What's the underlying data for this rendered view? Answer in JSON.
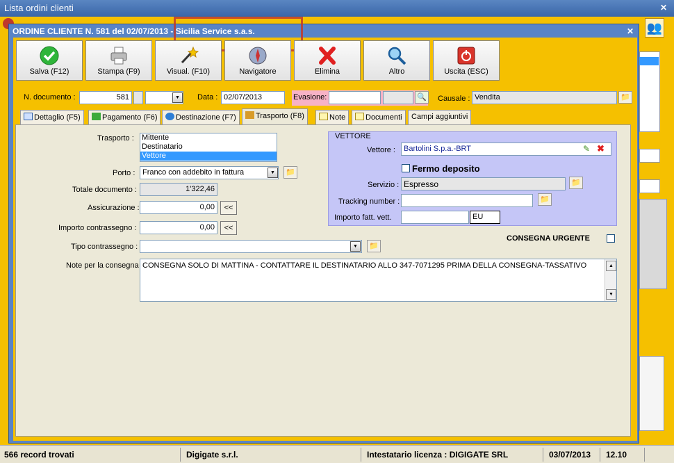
{
  "outer_window": {
    "title": "Lista ordini clienti"
  },
  "dialog": {
    "title": "ORDINE CLIENTE N. 581 del 02/07/2013 - Sicilia Service s.a.s."
  },
  "toolbar": [
    {
      "label": "Salva (F12)",
      "icon": "check-icon"
    },
    {
      "label": "Stampa (F9)",
      "icon": "printer-icon"
    },
    {
      "label": "Visual. (F10)",
      "icon": "magic-wand-icon"
    },
    {
      "label": "Navigatore",
      "icon": "compass-icon"
    },
    {
      "label": "Elimina",
      "icon": "delete-x-icon"
    },
    {
      "label": "Altro",
      "icon": "magnifier-icon"
    },
    {
      "label": "Uscita (ESC)",
      "icon": "exit-icon"
    }
  ],
  "header_fields": {
    "num_doc_label": "N. documento :",
    "num_doc_value": "581",
    "data_label": "Data :",
    "data_value": "02/07/2013",
    "evasione_label": "Evasione:",
    "evasione_value": "",
    "causale_label": "Causale :",
    "causale_value": "Vendita"
  },
  "tabs": [
    {
      "label": "Dettaglio (F5)",
      "active": false
    },
    {
      "label": "Pagamento (F6)",
      "active": false
    },
    {
      "label": "Destinazione (F7)",
      "active": false
    },
    {
      "label": "Trasporto (F8)",
      "active": true
    },
    {
      "label": "Note",
      "active": false
    },
    {
      "label": "Documenti",
      "active": false
    },
    {
      "label": "Campi aggiuntivi",
      "active": false
    }
  ],
  "trasporto": {
    "trasporto_label": "Trasporto :",
    "trasporto_options": [
      "Mittente",
      "Destinatario",
      "Vettore"
    ],
    "trasporto_selected": "Vettore",
    "porto_label": "Porto :",
    "porto_value": "Franco con addebito in fattura",
    "totale_label": "Totale documento :",
    "totale_value": "1'322,46",
    "assicurazione_label": "Assicurazione :",
    "assicurazione_value": "0,00",
    "contrassegno_label": "Importo contrassegno :",
    "contrassegno_value": "0,00",
    "tipo_contrassegno_label": "Tipo contrassegno :",
    "tipo_contrassegno_value": "",
    "note_label": "Note per la consegna",
    "note_value": "CONSEGNA SOLO DI MATTINA - CONTATTARE IL DESTINATARIO ALLO 347-7071295 PRIMA DELLA CONSEGNA-TASSATIVO",
    "back_button": "<<"
  },
  "vettore": {
    "group_title": "VETTORE",
    "vettore_label": "Vettore :",
    "vettore_value": "Bartolini S.p.a.-BRT",
    "fermo_label": "Fermo deposito",
    "servizio_label": "Servizio :",
    "servizio_value": "Espresso",
    "tracking_label": "Tracking number :",
    "tracking_value": "",
    "importo_label": "Importo fatt. vett.",
    "importo_value": "",
    "valuta_value": "EU",
    "urgente_label": "CONSEGNA URGENTE"
  },
  "statusbar": {
    "records": "566 record trovati",
    "company": "Digigate s.r.l.",
    "licenza": "Intestatario licenza : DIGIGATE SRL",
    "date": "03/07/2013",
    "version": "12.10"
  },
  "colors": {
    "accent": "#f5c000",
    "title_blue": "#5984c6",
    "vettore_bg": "#c5c6f7"
  }
}
